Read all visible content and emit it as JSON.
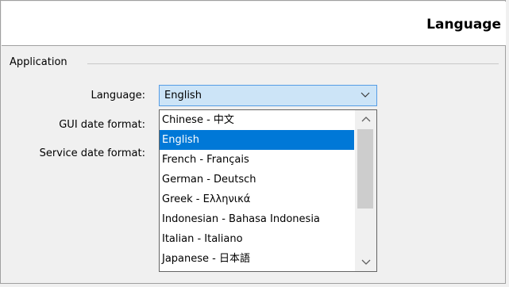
{
  "header": {
    "title": "Language"
  },
  "group": {
    "title": "Application"
  },
  "labels": {
    "language": "Language:",
    "gui_date_format": "GUI date format:",
    "service_date_format": "Service date format:"
  },
  "language_combo": {
    "selected": "English",
    "icon": "chevron-down-icon"
  },
  "dropdown": {
    "items": [
      "Chinese - 中文",
      "English",
      "French - Français",
      "German - Deutsch",
      "Greek - Ελληνικά",
      "Indonesian - Bahasa Indonesia",
      "Italian - Italiano",
      "Japanese - 日本語"
    ],
    "selected_index": 1
  },
  "colors": {
    "selection": "#0078d7",
    "combo_background": "#cce4f7",
    "combo_border": "#569de5"
  }
}
